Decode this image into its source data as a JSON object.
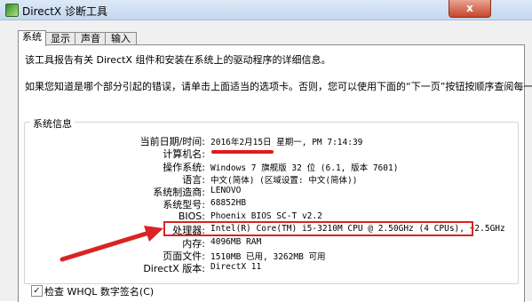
{
  "window": {
    "title": "DirectX 诊断工具",
    "close_glyph": "x"
  },
  "tabs": [
    {
      "label": "系统",
      "active": true
    },
    {
      "label": "显示",
      "active": false
    },
    {
      "label": "声音",
      "active": false
    },
    {
      "label": "输入",
      "active": false
    }
  ],
  "description": {
    "line1": "该工具报告有关 DirectX 组件和安装在系统上的驱动程序的详细信息。",
    "line2": "如果您知道是哪个部分引起的错误，请单击上面适当的选项卡。否则，您可以使用下面的“下一页”按钮按顺序查阅每一页。"
  },
  "system_info": {
    "group_title": "系统信息",
    "rows": [
      {
        "label": "当前日期/时间:",
        "value": "2016年2月15日 星期一, PM 7:14:39"
      },
      {
        "label": "计算机名:",
        "value": ""
      },
      {
        "label": "操作系统:",
        "value": "Windows 7 旗舰版 32 位 (6.1, 版本 7601)"
      },
      {
        "label": "语言:",
        "value": "中文(简体) (区域设置: 中文(简体))"
      },
      {
        "label": "系统制造商:",
        "value": "LENOVO"
      },
      {
        "label": "系统型号:",
        "value": "68852HB"
      },
      {
        "label": "BIOS:",
        "value": "Phoenix BIOS SC-T v2.2"
      },
      {
        "label": "处理器:",
        "value": "Intel(R) Core(TM) i5-3210M CPU @ 2.50GHz (4 CPUs), ~2.5GHz"
      },
      {
        "label": "内存:",
        "value": "4096MB RAM"
      },
      {
        "label": "页面文件:",
        "value": "1510MB 已用, 3262MB 可用"
      },
      {
        "label": "DirectX 版本:",
        "value": "DirectX 11"
      }
    ]
  },
  "whql_check": {
    "label": "检查 WHQL 数字签名(C)",
    "checked": true
  },
  "colors": {
    "annotation_red": "#d82424",
    "titlebar": "#c4d7ee"
  }
}
